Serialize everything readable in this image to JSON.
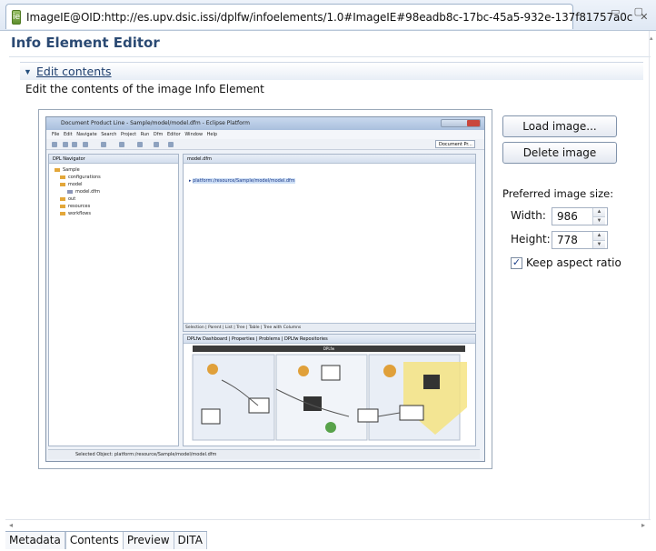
{
  "editor_tab": {
    "title": "ImageIE@OID:http://es.upv.dsic.issi/dplfw/infoelements/1.0#ImageIE#98eadb8c-17bc-45a5-932e-137f81757a0c",
    "icon": "image-ie-icon",
    "close": "✕"
  },
  "window_controls": "▭ ▢",
  "form": {
    "title": "Info Element Editor"
  },
  "section": {
    "title": "Edit contents",
    "description": "Edit the contents of the image Info Element"
  },
  "preview": {
    "window_title": "Document Product Line - Sample/model/model.dfm - Eclipse Platform",
    "menu": "File Edit Navigate Search Project Run Dfm Editor Window Help",
    "perspective": "Document Pr...",
    "navigator": {
      "header": "DPL Navigator",
      "tree": [
        {
          "label": "Sample",
          "level": 0
        },
        {
          "label": "configurations",
          "level": 1
        },
        {
          "label": "model",
          "level": 1
        },
        {
          "label": "model.dfm",
          "level": 2
        },
        {
          "label": "out",
          "level": 1
        },
        {
          "label": "resources",
          "level": 1
        },
        {
          "label": "workflows",
          "level": 1
        }
      ]
    },
    "editor": {
      "header": "model.dfm",
      "uri": "platform:/resource/Sample/model/model.dfm",
      "tabs": "Selection | Parent | List | Tree | Table | Tree with Columns"
    },
    "dashboard": {
      "header": "DPLfw Dashboard | Properties | Problems | DPLfw Repositories",
      "label": "DPLfw"
    },
    "status": "Selected Object: platform:/resource/Sample/model/model.dfm"
  },
  "actions": {
    "load_label": "Load image...",
    "delete_label": "Delete image"
  },
  "size": {
    "label": "Preferred image size:",
    "width_label": "Width:",
    "width_value": "986",
    "height_label": "Height:",
    "height_value": "778",
    "keep_ratio_label": "Keep aspect ratio",
    "keep_ratio_checked": true
  },
  "bottom_tabs": [
    {
      "label": "Metadata",
      "active": false
    },
    {
      "label": "Contents",
      "active": true
    },
    {
      "label": "Preview",
      "active": false
    },
    {
      "label": "DITA",
      "active": false
    }
  ]
}
